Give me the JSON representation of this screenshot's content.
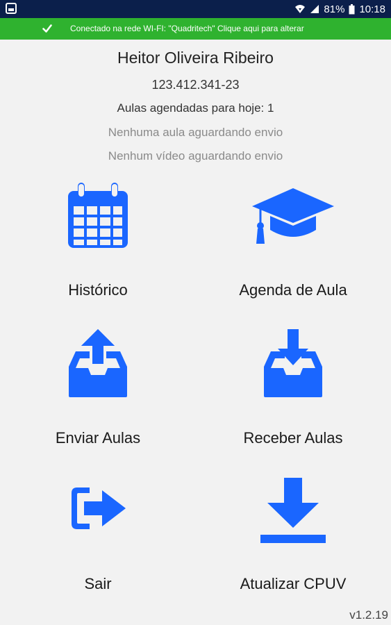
{
  "status_bar": {
    "battery_percent": "81%",
    "time": "10:18"
  },
  "wifi_banner": {
    "text": "Conectado na rede WI-FI: \"Quadritech\" Clique aqui para alterar"
  },
  "user": {
    "name": "Heitor Oliveira Ribeiro",
    "cpf": "123.412.341-23"
  },
  "summary": {
    "aulas_hoje": "Aulas agendadas para hoje: 1",
    "aula_envio": "Nenhuma aula aguardando envio",
    "video_envio": "Nenhum vídeo aguardando envio"
  },
  "menu": {
    "historico": "Histórico",
    "agenda": "Agenda de Aula",
    "enviar": "Enviar Aulas",
    "receber": "Receber Aulas",
    "sair": "Sair",
    "atualizar": "Atualizar CPUV"
  },
  "version": "v1.2.19",
  "colors": {
    "accent_blue": "#1a66ff",
    "banner_green": "#2fb22f",
    "status_bar": "#0b1f4b",
    "background": "#f2f2f2"
  },
  "icons": {
    "historico": "calendar-icon",
    "agenda": "graduation-cap-icon",
    "enviar": "upload-tray-icon",
    "receber": "download-tray-icon",
    "sair": "sign-out-icon",
    "atualizar": "download-icon"
  }
}
